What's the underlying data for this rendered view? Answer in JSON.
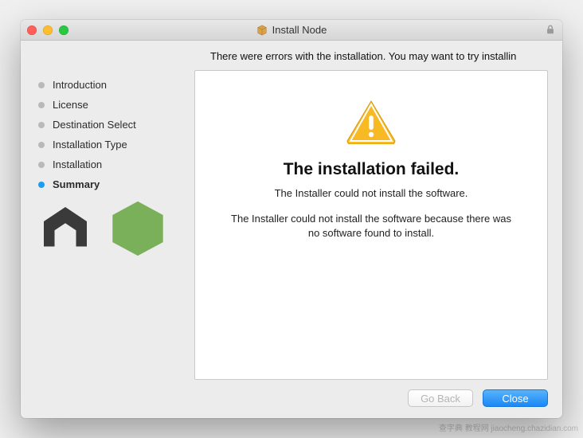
{
  "window": {
    "title": "Install Node"
  },
  "status_message": "There were errors with the installation. You may want to try installin",
  "sidebar": {
    "steps": [
      {
        "label": "Introduction",
        "current": false
      },
      {
        "label": "License",
        "current": false
      },
      {
        "label": "Destination Select",
        "current": false
      },
      {
        "label": "Installation Type",
        "current": false
      },
      {
        "label": "Installation",
        "current": false
      },
      {
        "label": "Summary",
        "current": true
      }
    ]
  },
  "content": {
    "title": "The installation failed.",
    "subtitle": "The Installer could not install the software.",
    "detail": "The Installer could not install the software because there was no software found to install."
  },
  "buttons": {
    "go_back": "Go Back",
    "close": "Close"
  },
  "watermark": "查字典 教程网 jiaocheng.chazidian.com"
}
